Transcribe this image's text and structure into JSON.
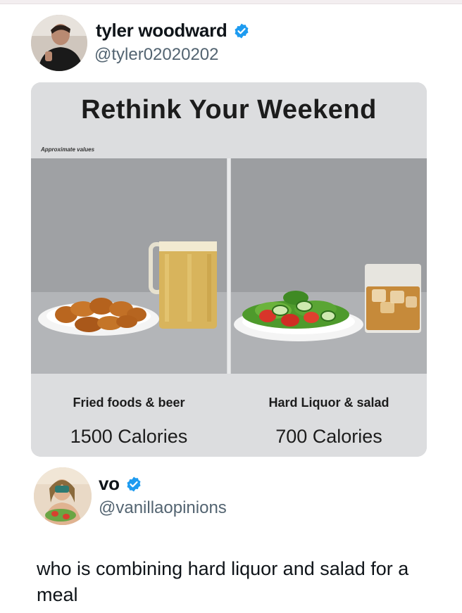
{
  "tweet1": {
    "display_name": "tyler woodward",
    "handle": "@tyler02020202",
    "verified_icon": "verified-badge-icon",
    "image": {
      "title": "Rethink Your Weekend",
      "note": "Approximate values",
      "left": {
        "caption": "Fried foods & beer",
        "calories": "1500 Calories"
      },
      "right": {
        "caption": "Hard Liquor & salad",
        "calories": "700 Calories"
      }
    }
  },
  "tweet2": {
    "display_name": "vo",
    "handle": "@vanillaopinions",
    "verified_icon": "verified-badge-icon",
    "text": "who is combining hard liquor and salad for a meal"
  },
  "colors": {
    "verified_blue": "#1d9bf0",
    "handle_gray": "#536471",
    "text_dark": "#0f1419"
  }
}
